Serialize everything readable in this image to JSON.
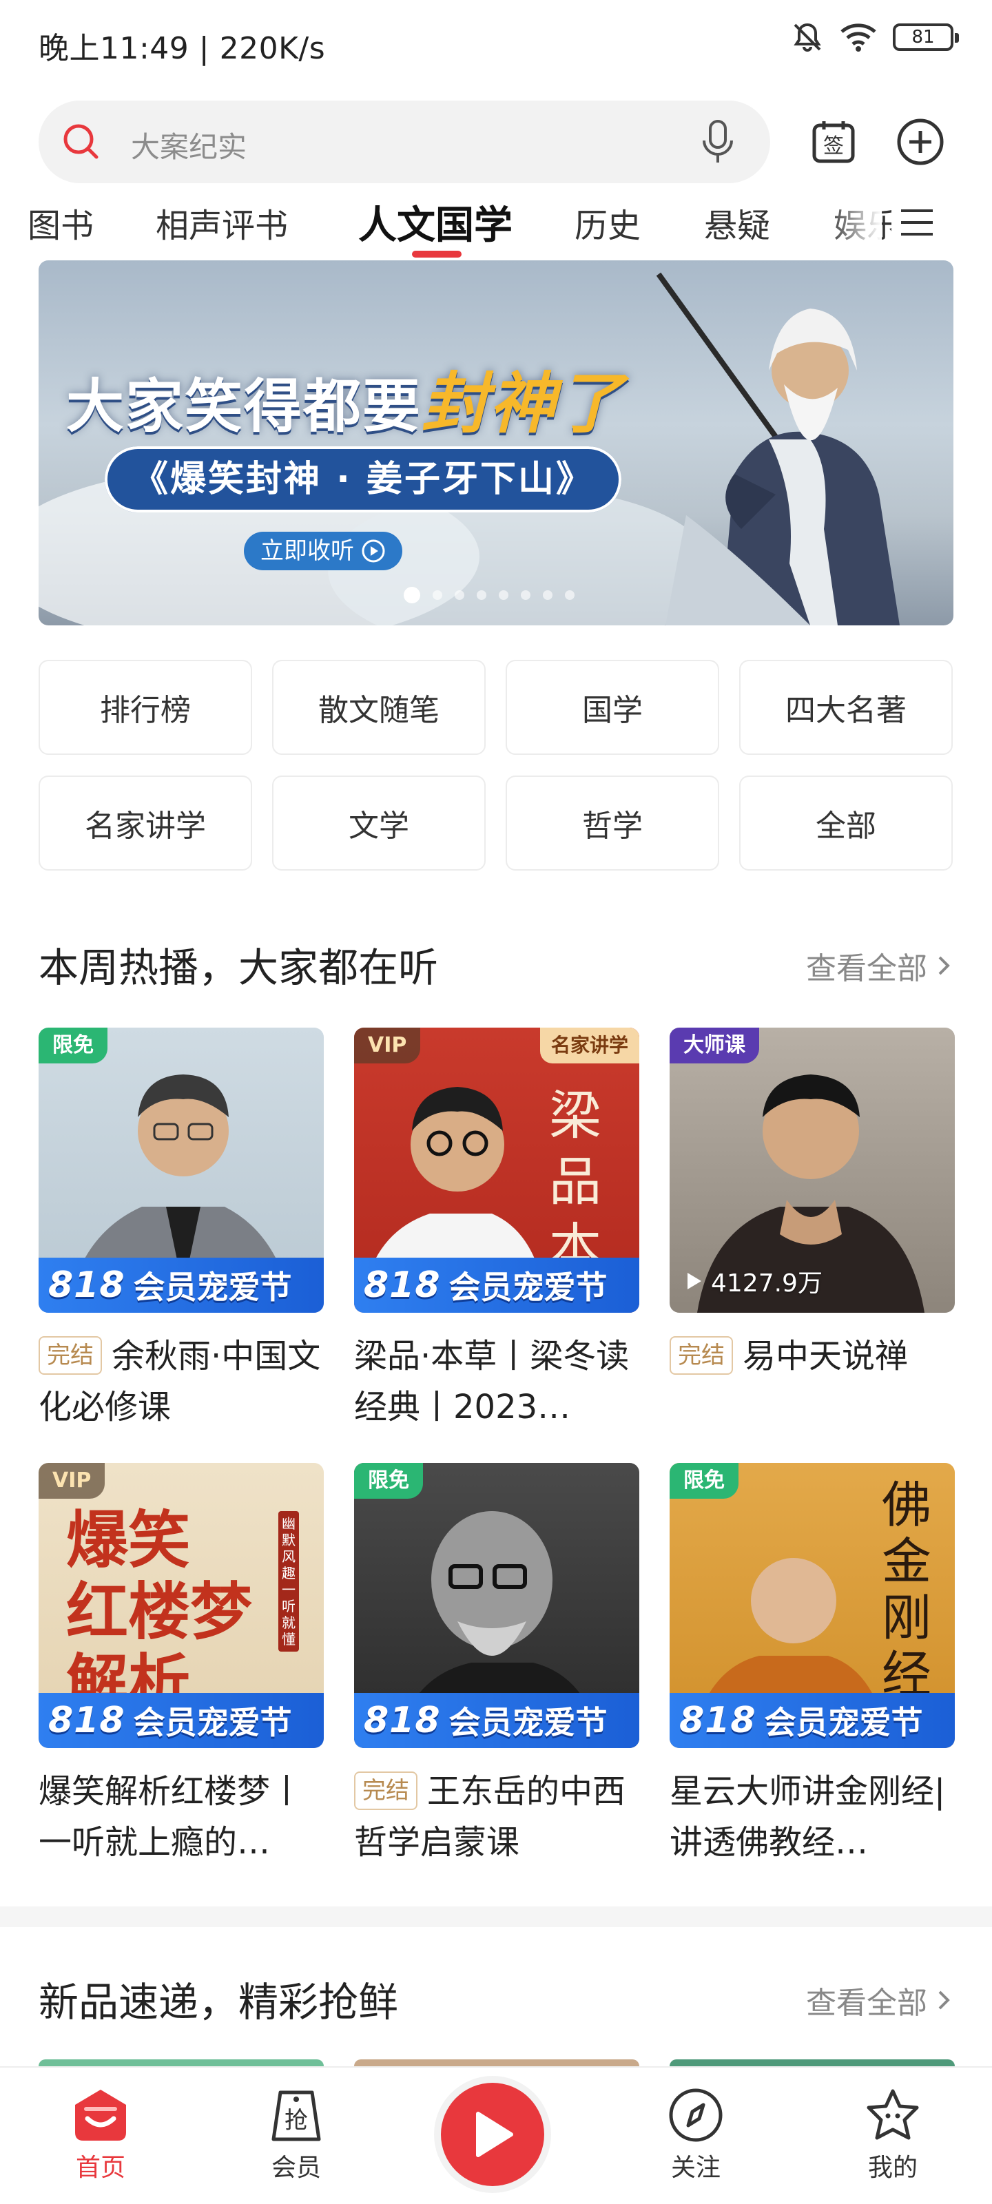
{
  "status_bar": {
    "time": "晚上11:49 | 220K/s",
    "battery": "81"
  },
  "search": {
    "placeholder": "大案纪实"
  },
  "tabs": [
    "图书",
    "相声评书",
    "人文国学",
    "历史",
    "悬疑",
    "娱乐"
  ],
  "active_tab": "人文国学",
  "banner": {
    "title_main": "大家笑得都要",
    "title_accent": "封神了",
    "subtitle": "《爆笑封神 · 姜子牙下山》",
    "button": "立即收听",
    "slides": 8,
    "active_slide": 1
  },
  "categories": [
    "排行榜",
    "散文随笔",
    "国学",
    "四大名著",
    "名家讲学",
    "文学",
    "哲学",
    "全部"
  ],
  "section1": {
    "title": "本周热播，大家都在听",
    "more": "查看全部",
    "promo_818": "818",
    "promo_text": "会员宠爱节",
    "done_tag": "完结",
    "items": [
      {
        "badge": "限免",
        "title": "余秋雨·中国文化必修课",
        "done": true
      },
      {
        "badge": "VIP",
        "badge_right": "名家讲学",
        "cover_text": "梁品 本草",
        "title": "梁品·本草丨梁冬读经典丨2023…",
        "done": false
      },
      {
        "badge": "大师课",
        "play_count": "4127.9万",
        "title": "易中天说禅",
        "done": true
      },
      {
        "badge": "VIP",
        "cover_text": "爆笑 红楼梦 解析",
        "cover_side": "幽默风趣 一听就懂",
        "title": "爆笑解析红楼梦丨一听就上瘾的…",
        "done": false
      },
      {
        "badge": "限免",
        "title": "王东岳的中西哲学启蒙课",
        "done": true
      },
      {
        "badge": "限免",
        "cover_text": "佛 金刚经讲",
        "title": "星云大师讲金刚经|讲透佛教经…",
        "done": false
      }
    ]
  },
  "section2": {
    "title": "新品速递，精彩抢鲜",
    "more": "查看全部"
  },
  "bottom_nav": {
    "home": "首页",
    "vip": "会员",
    "vip_icon_char": "抢",
    "follow": "关注",
    "mine": "我的"
  },
  "colors": {
    "accent": "#e8383d",
    "free_badge": "#2bb673",
    "promo_blue": "#2f7ff0"
  }
}
